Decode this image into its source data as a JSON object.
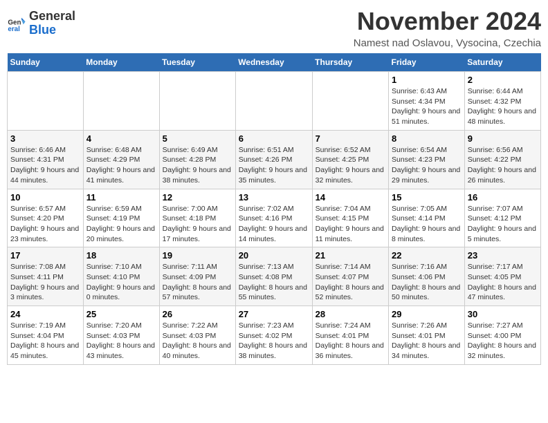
{
  "header": {
    "logo_general": "General",
    "logo_blue": "Blue",
    "month_title": "November 2024",
    "subtitle": "Namest nad Oslavou, Vysocina, Czechia"
  },
  "days_of_week": [
    "Sunday",
    "Monday",
    "Tuesday",
    "Wednesday",
    "Thursday",
    "Friday",
    "Saturday"
  ],
  "weeks": [
    [
      {
        "day": "",
        "info": ""
      },
      {
        "day": "",
        "info": ""
      },
      {
        "day": "",
        "info": ""
      },
      {
        "day": "",
        "info": ""
      },
      {
        "day": "",
        "info": ""
      },
      {
        "day": "1",
        "info": "Sunrise: 6:43 AM\nSunset: 4:34 PM\nDaylight: 9 hours and 51 minutes."
      },
      {
        "day": "2",
        "info": "Sunrise: 6:44 AM\nSunset: 4:32 PM\nDaylight: 9 hours and 48 minutes."
      }
    ],
    [
      {
        "day": "3",
        "info": "Sunrise: 6:46 AM\nSunset: 4:31 PM\nDaylight: 9 hours and 44 minutes."
      },
      {
        "day": "4",
        "info": "Sunrise: 6:48 AM\nSunset: 4:29 PM\nDaylight: 9 hours and 41 minutes."
      },
      {
        "day": "5",
        "info": "Sunrise: 6:49 AM\nSunset: 4:28 PM\nDaylight: 9 hours and 38 minutes."
      },
      {
        "day": "6",
        "info": "Sunrise: 6:51 AM\nSunset: 4:26 PM\nDaylight: 9 hours and 35 minutes."
      },
      {
        "day": "7",
        "info": "Sunrise: 6:52 AM\nSunset: 4:25 PM\nDaylight: 9 hours and 32 minutes."
      },
      {
        "day": "8",
        "info": "Sunrise: 6:54 AM\nSunset: 4:23 PM\nDaylight: 9 hours and 29 minutes."
      },
      {
        "day": "9",
        "info": "Sunrise: 6:56 AM\nSunset: 4:22 PM\nDaylight: 9 hours and 26 minutes."
      }
    ],
    [
      {
        "day": "10",
        "info": "Sunrise: 6:57 AM\nSunset: 4:20 PM\nDaylight: 9 hours and 23 minutes."
      },
      {
        "day": "11",
        "info": "Sunrise: 6:59 AM\nSunset: 4:19 PM\nDaylight: 9 hours and 20 minutes."
      },
      {
        "day": "12",
        "info": "Sunrise: 7:00 AM\nSunset: 4:18 PM\nDaylight: 9 hours and 17 minutes."
      },
      {
        "day": "13",
        "info": "Sunrise: 7:02 AM\nSunset: 4:16 PM\nDaylight: 9 hours and 14 minutes."
      },
      {
        "day": "14",
        "info": "Sunrise: 7:04 AM\nSunset: 4:15 PM\nDaylight: 9 hours and 11 minutes."
      },
      {
        "day": "15",
        "info": "Sunrise: 7:05 AM\nSunset: 4:14 PM\nDaylight: 9 hours and 8 minutes."
      },
      {
        "day": "16",
        "info": "Sunrise: 7:07 AM\nSunset: 4:12 PM\nDaylight: 9 hours and 5 minutes."
      }
    ],
    [
      {
        "day": "17",
        "info": "Sunrise: 7:08 AM\nSunset: 4:11 PM\nDaylight: 9 hours and 3 minutes."
      },
      {
        "day": "18",
        "info": "Sunrise: 7:10 AM\nSunset: 4:10 PM\nDaylight: 9 hours and 0 minutes."
      },
      {
        "day": "19",
        "info": "Sunrise: 7:11 AM\nSunset: 4:09 PM\nDaylight: 8 hours and 57 minutes."
      },
      {
        "day": "20",
        "info": "Sunrise: 7:13 AM\nSunset: 4:08 PM\nDaylight: 8 hours and 55 minutes."
      },
      {
        "day": "21",
        "info": "Sunrise: 7:14 AM\nSunset: 4:07 PM\nDaylight: 8 hours and 52 minutes."
      },
      {
        "day": "22",
        "info": "Sunrise: 7:16 AM\nSunset: 4:06 PM\nDaylight: 8 hours and 50 minutes."
      },
      {
        "day": "23",
        "info": "Sunrise: 7:17 AM\nSunset: 4:05 PM\nDaylight: 8 hours and 47 minutes."
      }
    ],
    [
      {
        "day": "24",
        "info": "Sunrise: 7:19 AM\nSunset: 4:04 PM\nDaylight: 8 hours and 45 minutes."
      },
      {
        "day": "25",
        "info": "Sunrise: 7:20 AM\nSunset: 4:03 PM\nDaylight: 8 hours and 43 minutes."
      },
      {
        "day": "26",
        "info": "Sunrise: 7:22 AM\nSunset: 4:03 PM\nDaylight: 8 hours and 40 minutes."
      },
      {
        "day": "27",
        "info": "Sunrise: 7:23 AM\nSunset: 4:02 PM\nDaylight: 8 hours and 38 minutes."
      },
      {
        "day": "28",
        "info": "Sunrise: 7:24 AM\nSunset: 4:01 PM\nDaylight: 8 hours and 36 minutes."
      },
      {
        "day": "29",
        "info": "Sunrise: 7:26 AM\nSunset: 4:01 PM\nDaylight: 8 hours and 34 minutes."
      },
      {
        "day": "30",
        "info": "Sunrise: 7:27 AM\nSunset: 4:00 PM\nDaylight: 8 hours and 32 minutes."
      }
    ]
  ]
}
